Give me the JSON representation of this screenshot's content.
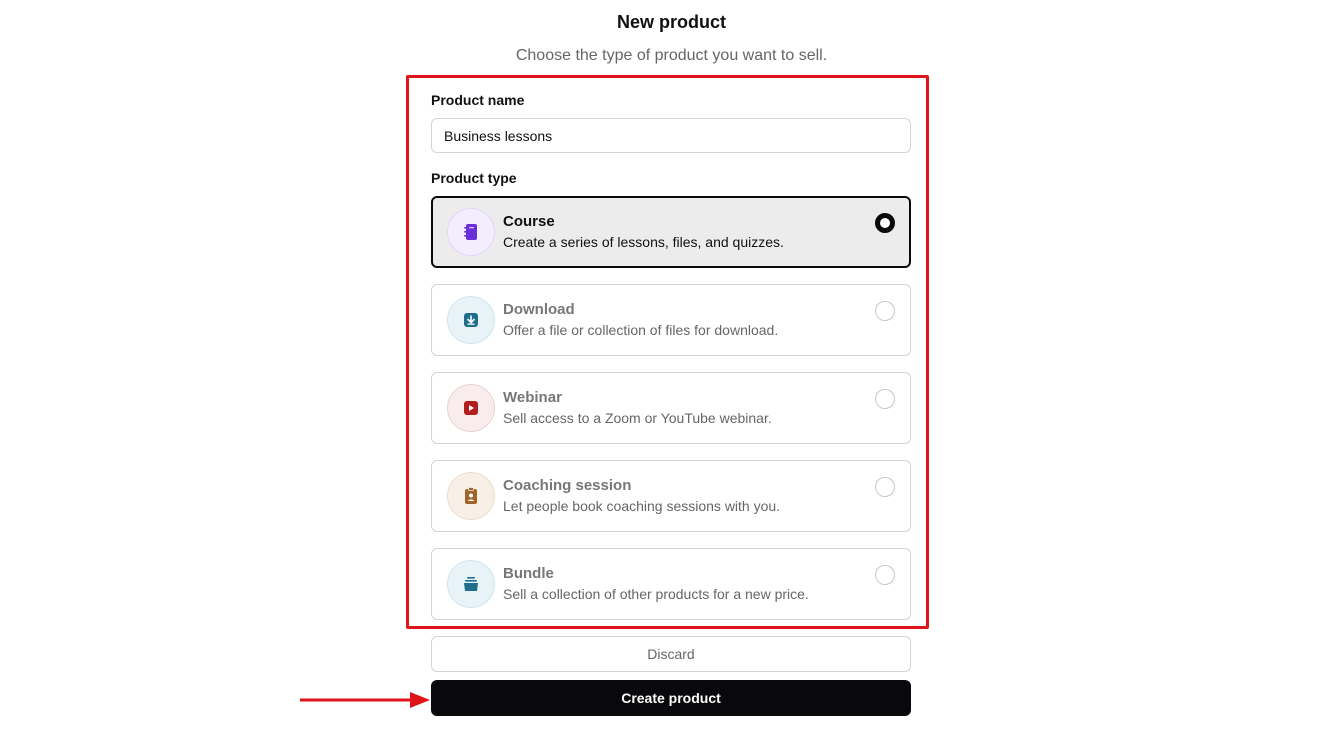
{
  "header": {
    "title": "New product",
    "subtitle": "Choose the type of product you want to sell."
  },
  "form": {
    "name_label": "Product name",
    "name_value": "Business lessons",
    "type_label": "Product type",
    "options": [
      {
        "title": "Course",
        "description": "Create a series of lessons, files, and quizzes.",
        "icon": "notebook-icon",
        "selected": true,
        "color": "#6b2fd9",
        "bg": "#f3edfd"
      },
      {
        "title": "Download",
        "description": "Offer a file or collection of files for download.",
        "icon": "download-icon",
        "selected": false,
        "color": "#1f6e8c",
        "bg": "#e8f3f8"
      },
      {
        "title": "Webinar",
        "description": "Sell access to a Zoom or YouTube webinar.",
        "icon": "video-play-icon",
        "selected": false,
        "color": "#b51d1d",
        "bg": "#f8ecec"
      },
      {
        "title": "Coaching session",
        "description": "Let people book coaching sessions with you.",
        "icon": "clipboard-person-icon",
        "selected": false,
        "color": "#a0642a",
        "bg": "#f8efe6"
      },
      {
        "title": "Bundle",
        "description": "Sell a collection of other products for a new price.",
        "icon": "stack-icon",
        "selected": false,
        "color": "#1f6e8c",
        "bg": "#e8f3f8"
      }
    ]
  },
  "actions": {
    "discard_label": "Discard",
    "create_label": "Create product"
  },
  "annotation": {
    "highlight_color": "#e0121a"
  }
}
